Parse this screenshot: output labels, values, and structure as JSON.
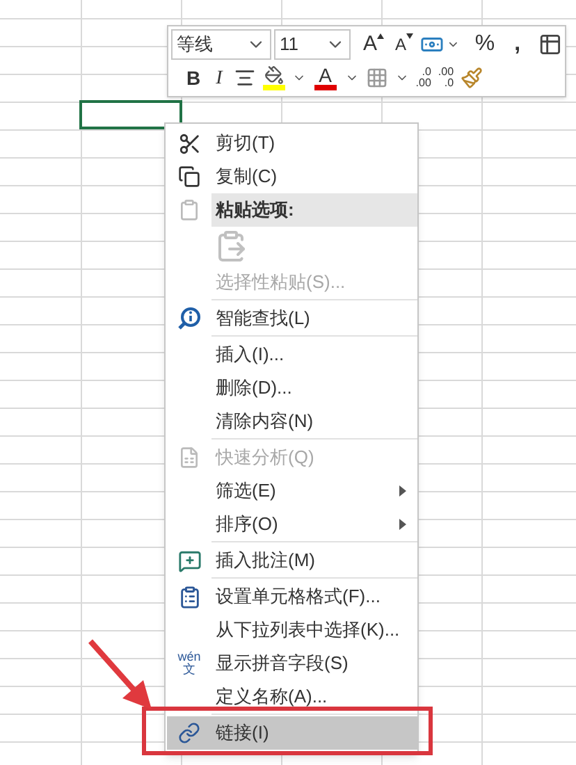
{
  "toolbar": {
    "font_name": "等线",
    "font_size": "11",
    "grow_font": "A",
    "shrink_font": "A",
    "percent": "%",
    "comma": ",",
    "bold": "B",
    "italic": "I",
    "fill_button": {
      "color": "#ffff00"
    },
    "font_color_button": {
      "label": "A",
      "color": "#e00000"
    },
    "increase_decimal": {
      "top": ".0",
      "bottom": ".00"
    },
    "decrease_decimal": {
      "top": ".00",
      "bottom": ".0"
    }
  },
  "menu": [
    {
      "kind": "item",
      "label": "剪切(T)",
      "disabled": false,
      "submenu": false,
      "selected": false
    },
    {
      "kind": "item",
      "label": "复制(C)",
      "disabled": false,
      "submenu": false,
      "selected": false
    },
    {
      "kind": "header",
      "label": "粘贴选项:"
    },
    {
      "kind": "paste-options"
    },
    {
      "kind": "item",
      "label": "选择性粘贴(S)...",
      "disabled": true,
      "submenu": false,
      "selected": false
    },
    {
      "kind": "separator"
    },
    {
      "kind": "item",
      "label": "智能查找(L)",
      "disabled": false,
      "submenu": false,
      "selected": false
    },
    {
      "kind": "separator"
    },
    {
      "kind": "item",
      "label": "插入(I)...",
      "disabled": false,
      "submenu": false,
      "selected": false
    },
    {
      "kind": "item",
      "label": "删除(D)...",
      "disabled": false,
      "submenu": false,
      "selected": false
    },
    {
      "kind": "item",
      "label": "清除内容(N)",
      "disabled": false,
      "submenu": false,
      "selected": false
    },
    {
      "kind": "separator"
    },
    {
      "kind": "item",
      "label": "快速分析(Q)",
      "disabled": true,
      "submenu": false,
      "selected": false
    },
    {
      "kind": "item",
      "label": "筛选(E)",
      "disabled": false,
      "submenu": true,
      "selected": false
    },
    {
      "kind": "item",
      "label": "排序(O)",
      "disabled": false,
      "submenu": true,
      "selected": false
    },
    {
      "kind": "separator"
    },
    {
      "kind": "item",
      "label": "插入批注(M)",
      "disabled": false,
      "submenu": false,
      "selected": false
    },
    {
      "kind": "separator"
    },
    {
      "kind": "item",
      "label": "设置单元格格式(F)...",
      "disabled": false,
      "submenu": false,
      "selected": false
    },
    {
      "kind": "item",
      "label": "从下拉列表中选择(K)...",
      "disabled": false,
      "submenu": false,
      "selected": false
    },
    {
      "kind": "item",
      "label": "显示拼音字段(S)",
      "disabled": false,
      "submenu": false,
      "selected": false,
      "badge_text": [
        "wén",
        "文"
      ]
    },
    {
      "kind": "item",
      "label": "定义名称(A)...",
      "disabled": false,
      "submenu": false,
      "selected": false
    },
    {
      "kind": "separator"
    },
    {
      "kind": "item",
      "label": "链接(I)",
      "disabled": false,
      "submenu": false,
      "selected": true
    }
  ]
}
